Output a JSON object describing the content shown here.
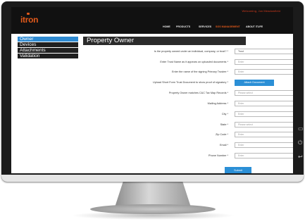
{
  "header": {
    "account_text": "Welcoming, Jon Meadowfield",
    "logo_text": "itron",
    "nav": [
      "HOME",
      "PRODUCTS",
      "SERVICES",
      "SGS MANAGEMENT",
      "ABOUT ITUFE"
    ],
    "active_nav_index": 3
  },
  "sidebar": {
    "items": [
      "Owner",
      "Devices",
      "Attachments",
      "Validation"
    ],
    "active_index": 0
  },
  "form": {
    "title": "Property Owner",
    "fields": [
      {
        "label": "Is the property owned under an individual, company, or trust? *",
        "type": "select",
        "value": "Trust"
      },
      {
        "label": "Enter Trust Name as it appears on uploaded documents *",
        "type": "input",
        "placeholder": "Enter"
      },
      {
        "label": "Enter the name of the signing Primary Trustee *",
        "type": "input",
        "placeholder": "Enter"
      },
      {
        "label": "Upload Short Form Trust Document to show proof of signatory *",
        "type": "button",
        "button_label": "Attach Document"
      },
      {
        "label": "Property Owner matches C&C Tax Map Records *",
        "type": "select",
        "value": "Please select"
      },
      {
        "label": "Mailing Address *",
        "type": "input",
        "placeholder": "Enter"
      },
      {
        "label": "City *",
        "type": "input",
        "placeholder": "Enter"
      },
      {
        "label": "State *",
        "type": "select",
        "value": "Please select"
      },
      {
        "label": "Zip Code *",
        "type": "input",
        "placeholder": "Enter"
      },
      {
        "label": "Email *",
        "type": "input",
        "placeholder": "Enter"
      },
      {
        "label": "Phone Number *",
        "type": "input",
        "placeholder": "Enter"
      }
    ],
    "submit_label": "Submit"
  },
  "device": {
    "side_icons": [
      "tablet-icon",
      "power-icon",
      "back-icon"
    ]
  }
}
